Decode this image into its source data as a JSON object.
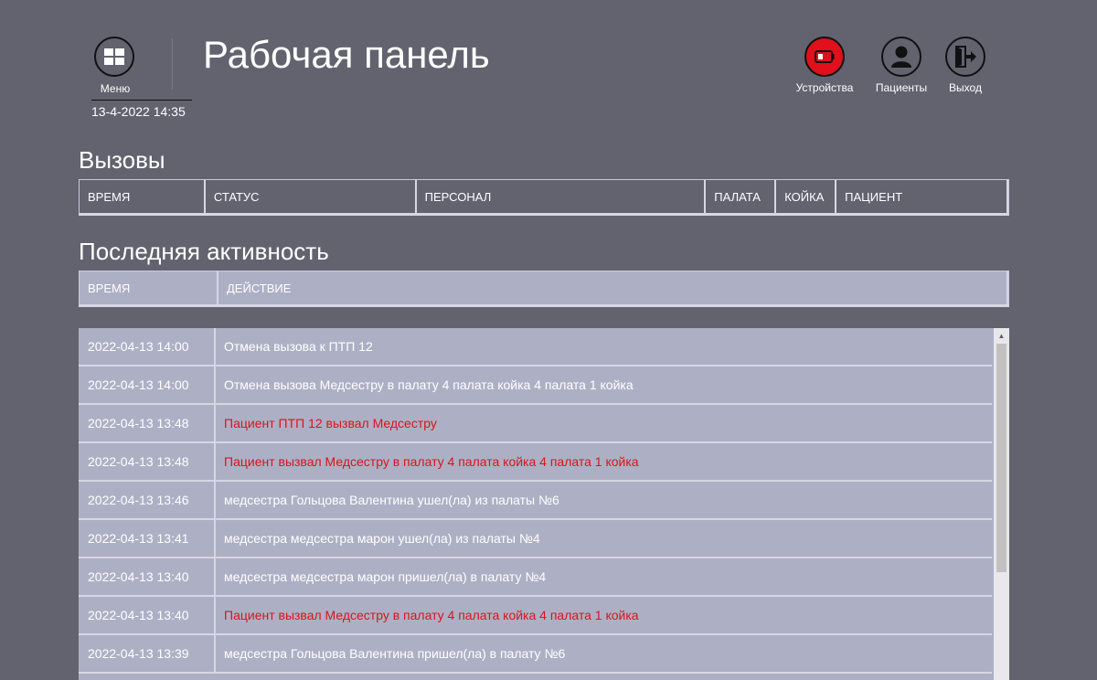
{
  "header": {
    "title": "Рабочая панель",
    "menu_label": "Меню",
    "datetime": "13-4-2022 14:35",
    "buttons": {
      "devices": "Устройства",
      "patients": "Пациенты",
      "exit": "Выход"
    }
  },
  "calls": {
    "title": "Вызовы",
    "columns": [
      "ВРЕМЯ",
      "СТАТУС",
      "ПЕРСОНАЛ",
      "ПАЛАТА",
      "КОЙКА",
      "ПАЦИЕНТ"
    ]
  },
  "activity": {
    "title": "Последняя активность",
    "columns": [
      "ВРЕМЯ",
      "ДЕЙСТВИЕ"
    ],
    "rows": [
      {
        "time": "2022-04-13 14:00",
        "action": "Отмена вызова к ПТП 12",
        "alert": false
      },
      {
        "time": "2022-04-13 14:00",
        "action": "Отмена вызова Медсестру в палату 4 палата койка 4 палата 1 койка",
        "alert": false
      },
      {
        "time": "2022-04-13 13:48",
        "action": "Пациент ПТП 12 вызвал Медсестру",
        "alert": true
      },
      {
        "time": "2022-04-13 13:48",
        "action": "Пациент вызвал Медсестру в палату 4 палата койка 4 палата 1 койка",
        "alert": true
      },
      {
        "time": "2022-04-13 13:46",
        "action": "медсестра Гольцова Валентина ушел(ла) из палаты №6",
        "alert": false
      },
      {
        "time": "2022-04-13 13:41",
        "action": "медсестра медсестра марон ушел(ла) из палаты №4",
        "alert": false
      },
      {
        "time": "2022-04-13 13:40",
        "action": "медсестра медсестра марон пришел(ла) в палату №4",
        "alert": false
      },
      {
        "time": "2022-04-13 13:40",
        "action": "Пациент вызвал Медсестру в палату 4 палата койка 4 палата 1 койка",
        "alert": true
      },
      {
        "time": "2022-04-13 13:39",
        "action": "медсестра Гольцова Валентина пришел(ла) в палату №6",
        "alert": false
      }
    ]
  },
  "colors": {
    "background": "#62636f",
    "row": "#adb0c5",
    "alert_text": "#d8141e",
    "devices_button": "#e0101c"
  },
  "icons": {
    "menu": "grid-icon",
    "devices": "battery-icon",
    "patients": "user-icon",
    "exit": "exit-door-icon",
    "scroll_up": "chevron-up-icon"
  }
}
